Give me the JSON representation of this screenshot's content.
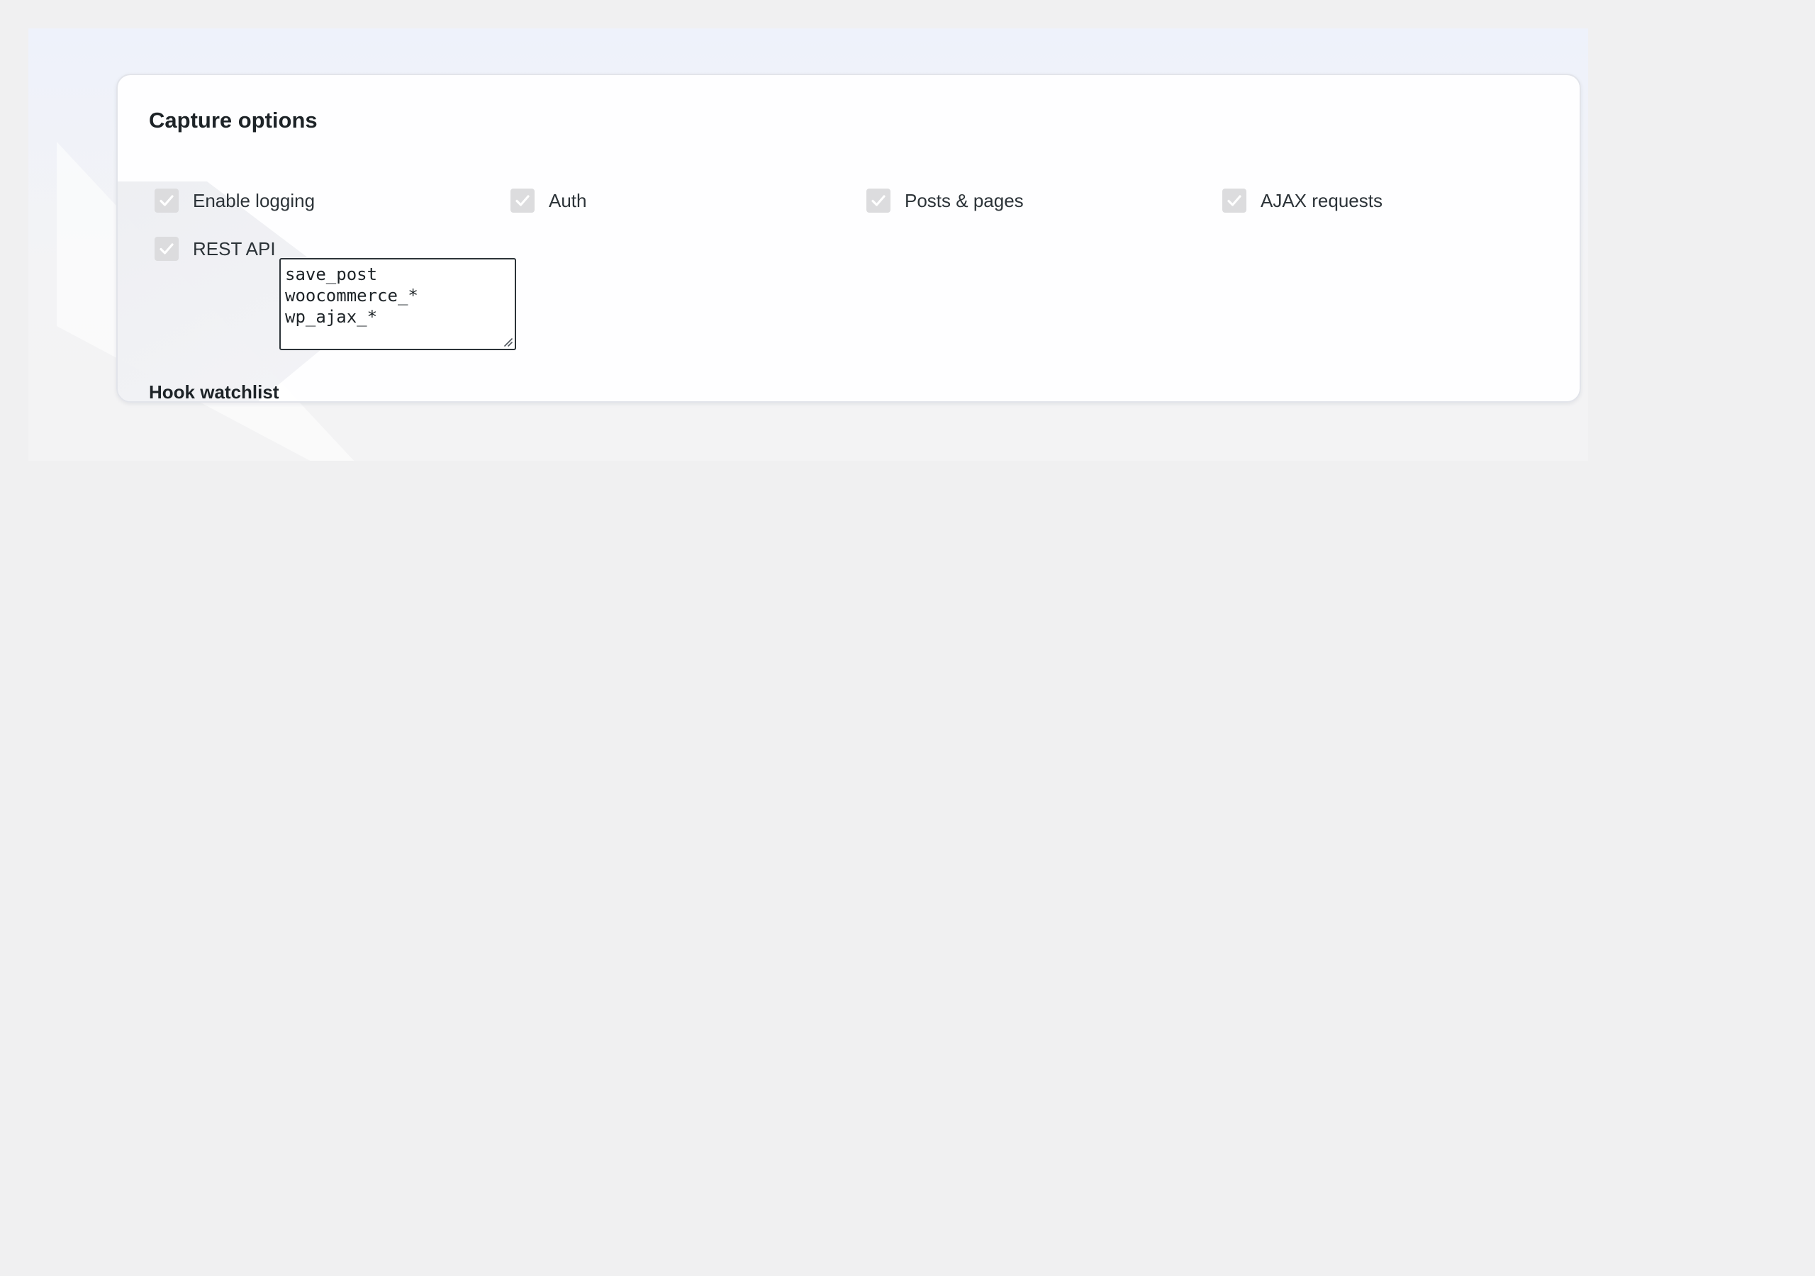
{
  "capture_options": {
    "title": "Capture options",
    "options": [
      {
        "label": "Enable logging",
        "checked": true
      },
      {
        "label": "Auth",
        "checked": true
      },
      {
        "label": "Posts & pages",
        "checked": true
      },
      {
        "label": "AJAX requests",
        "checked": true
      },
      {
        "label": "REST API",
        "checked": true
      }
    ],
    "hook_watchlist": {
      "label": "Hook watchlist",
      "lines": [
        "save_post",
        "woocommerce_*",
        "wp_ajax_*"
      ]
    }
  },
  "colors": {
    "checkbox_fill": "#dcdcde",
    "checkmark": "#ffffff",
    "text": "#1d2327"
  },
  "icons": {
    "checkbox": "checkmark-icon",
    "textarea_resize": "resize-grip-icon"
  }
}
